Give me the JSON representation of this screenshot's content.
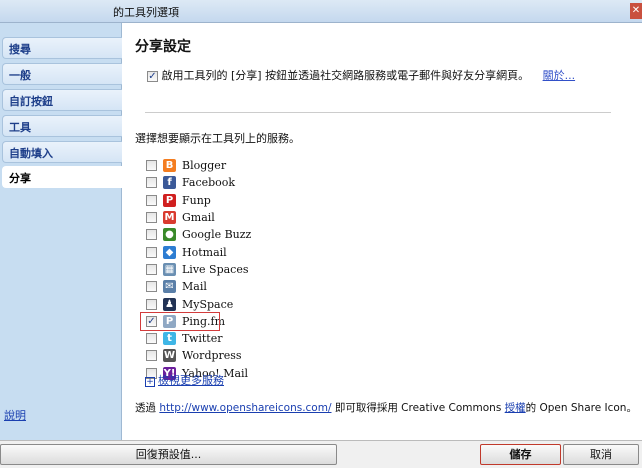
{
  "window": {
    "title": "的工具列選項",
    "close_icon": "close-icon"
  },
  "sidebar": {
    "tabs": [
      "搜尋",
      "一般",
      "自訂按鈕",
      "工具",
      "自動填入",
      "分享"
    ],
    "active": "分享",
    "help": "說明"
  },
  "main": {
    "heading": "分享設定",
    "enable_text": "啟用工具列的 [分享] 按鈕並透過社交網路服務或電子郵件與好友分享網頁。",
    "enable_checked": true,
    "about_link": "關於...",
    "choose_text": "選擇想要顯示在工具列上的服務。",
    "services": [
      {
        "name": "Blogger",
        "checked": false,
        "icon": "B",
        "color": "#f47d20"
      },
      {
        "name": "Facebook",
        "checked": false,
        "icon": "f",
        "color": "#3b5998"
      },
      {
        "name": "Funp",
        "checked": false,
        "icon": "P",
        "color": "#d01f1f"
      },
      {
        "name": "Gmail",
        "checked": false,
        "icon": "M",
        "color": "#d93b2f"
      },
      {
        "name": "Google Buzz",
        "checked": false,
        "icon": "●",
        "color": "#3a8a2a"
      },
      {
        "name": "Hotmail",
        "checked": false,
        "icon": "◆",
        "color": "#2d7dd2"
      },
      {
        "name": "Live Spaces",
        "checked": false,
        "icon": "▦",
        "color": "#6a8fb2"
      },
      {
        "name": "Mail",
        "checked": false,
        "icon": "✉",
        "color": "#5a7fa8"
      },
      {
        "name": "MySpace",
        "checked": false,
        "icon": "♟",
        "color": "#223355"
      },
      {
        "name": "Ping.fm",
        "checked": true,
        "icon": "P",
        "color": "#8fa8c4"
      },
      {
        "name": "Twitter",
        "checked": false,
        "icon": "t",
        "color": "#3fb6e6"
      },
      {
        "name": "Wordpress",
        "checked": false,
        "icon": "W",
        "color": "#555"
      },
      {
        "name": "Yahoo! Mail",
        "checked": false,
        "icon": "Y!",
        "color": "#6b1e9c"
      }
    ],
    "more_link": "檢視更多服務",
    "credit": {
      "prefix": "透過",
      "url": "http://www.openshareicons.com/",
      "middle": "即可取得採用 Creative Commons",
      "license": "授權",
      "suffix": "的 Open Share Icon。"
    }
  },
  "buttons": {
    "reset": "回復預設值...",
    "save": "儲存",
    "cancel": "取消"
  }
}
